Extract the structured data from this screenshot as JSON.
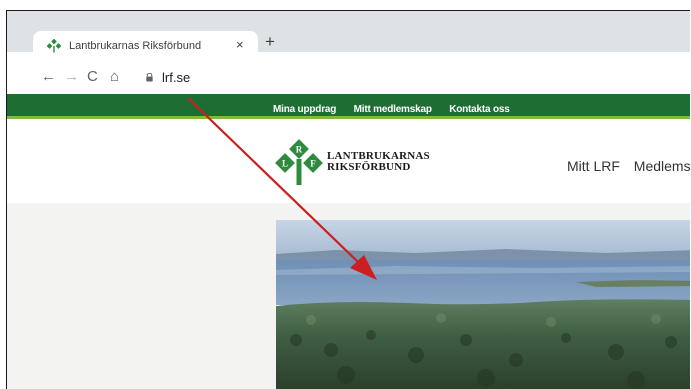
{
  "browser": {
    "tab_title": "Lantbrukarnas Riksförbund",
    "tab_close": "×",
    "new_tab": "+",
    "url": "lrf.se",
    "nav": {
      "back": "←",
      "forward": "→",
      "reload": "C",
      "home": "⌂"
    }
  },
  "site": {
    "top_links": [
      "Mina uppdrag",
      "Mitt medlemskap",
      "Kontakta oss"
    ],
    "logo": {
      "line1": "LANTBRUKARNAS",
      "line2": "RIKSFÖRBUND",
      "letters": [
        "R",
        "L",
        "F"
      ]
    },
    "main_nav": [
      "Mitt LRF",
      "Medlems"
    ]
  },
  "colors": {
    "green_bar": "#1e6e33",
    "accent_green": "#86b83b",
    "logo_green": "#2e8b3e",
    "annotation_red": "#cc1f1f"
  },
  "icons": {
    "favicon": "lrf-clover-icon",
    "lock": "lock-icon"
  }
}
